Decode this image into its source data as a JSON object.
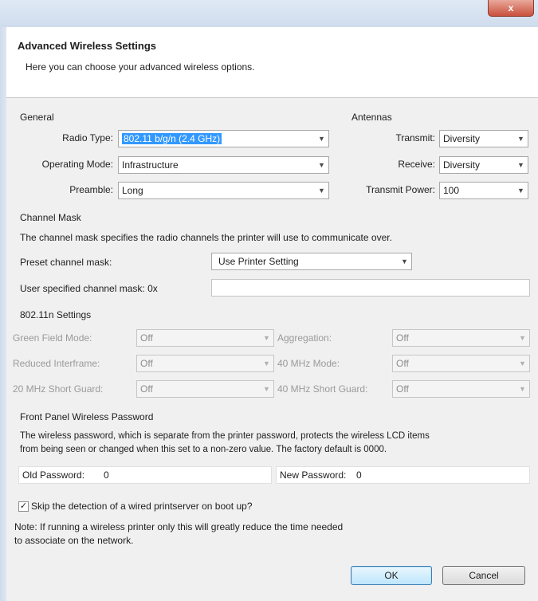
{
  "window": {
    "close_glyph": "x"
  },
  "header": {
    "title": "Advanced Wireless Settings",
    "description": "Here you can choose your advanced wireless options."
  },
  "general": {
    "title": "General",
    "radio_type_label": "Radio Type:",
    "radio_type_value": "802.11 b/g/n (2.4 GHz)",
    "operating_mode_label": "Operating Mode:",
    "operating_mode_value": "Infrastructure",
    "preamble_label": "Preamble:",
    "preamble_value": "Long"
  },
  "antennas": {
    "title": "Antennas",
    "transmit_label": "Transmit:",
    "transmit_value": "Diversity",
    "receive_label": "Receive:",
    "receive_value": "Diversity",
    "transmit_power_label": "Transmit Power:",
    "transmit_power_value": "100"
  },
  "channel_mask": {
    "title": "Channel Mask",
    "description": "The channel mask specifies the radio channels the printer will use to communicate over.",
    "preset_label": "Preset channel mask:",
    "preset_value": "Use Printer Setting",
    "user_label": "User specified channel mask: 0x",
    "user_value": ""
  },
  "n_settings": {
    "title": "802.11n Settings",
    "rows": [
      {
        "left_label": "Green Field Mode:",
        "left_value": "Off",
        "right_label": "Aggregation:",
        "right_value": "Off"
      },
      {
        "left_label": "Reduced Interframe:",
        "left_value": "Off",
        "right_label": "40 MHz Mode:",
        "right_value": "Off"
      },
      {
        "left_label": "20 MHz Short Guard:",
        "left_value": "Off",
        "right_label": "40 MHz Short Guard:",
        "right_value": "Off"
      }
    ]
  },
  "password": {
    "title": "Front Panel Wireless Password",
    "description_line1": "The wireless password, which is separate from the printer password, protects the wireless LCD items",
    "description_line2": "from being seen or changed when this set to a non-zero value. The factory default is 0000.",
    "old_label": "Old Password:",
    "old_value": "0",
    "new_label": "New Password:",
    "new_value": "0"
  },
  "skip": {
    "checked": true,
    "check_glyph": "✓",
    "label": "Skip the detection of a wired printserver on boot up?",
    "note_line1": "Note: If running a wireless printer only this will greatly reduce the time needed",
    "note_line2": "to associate on the network."
  },
  "buttons": {
    "ok": "OK",
    "cancel": "Cancel"
  },
  "icons": {
    "dropdown_arrow": "▼"
  }
}
